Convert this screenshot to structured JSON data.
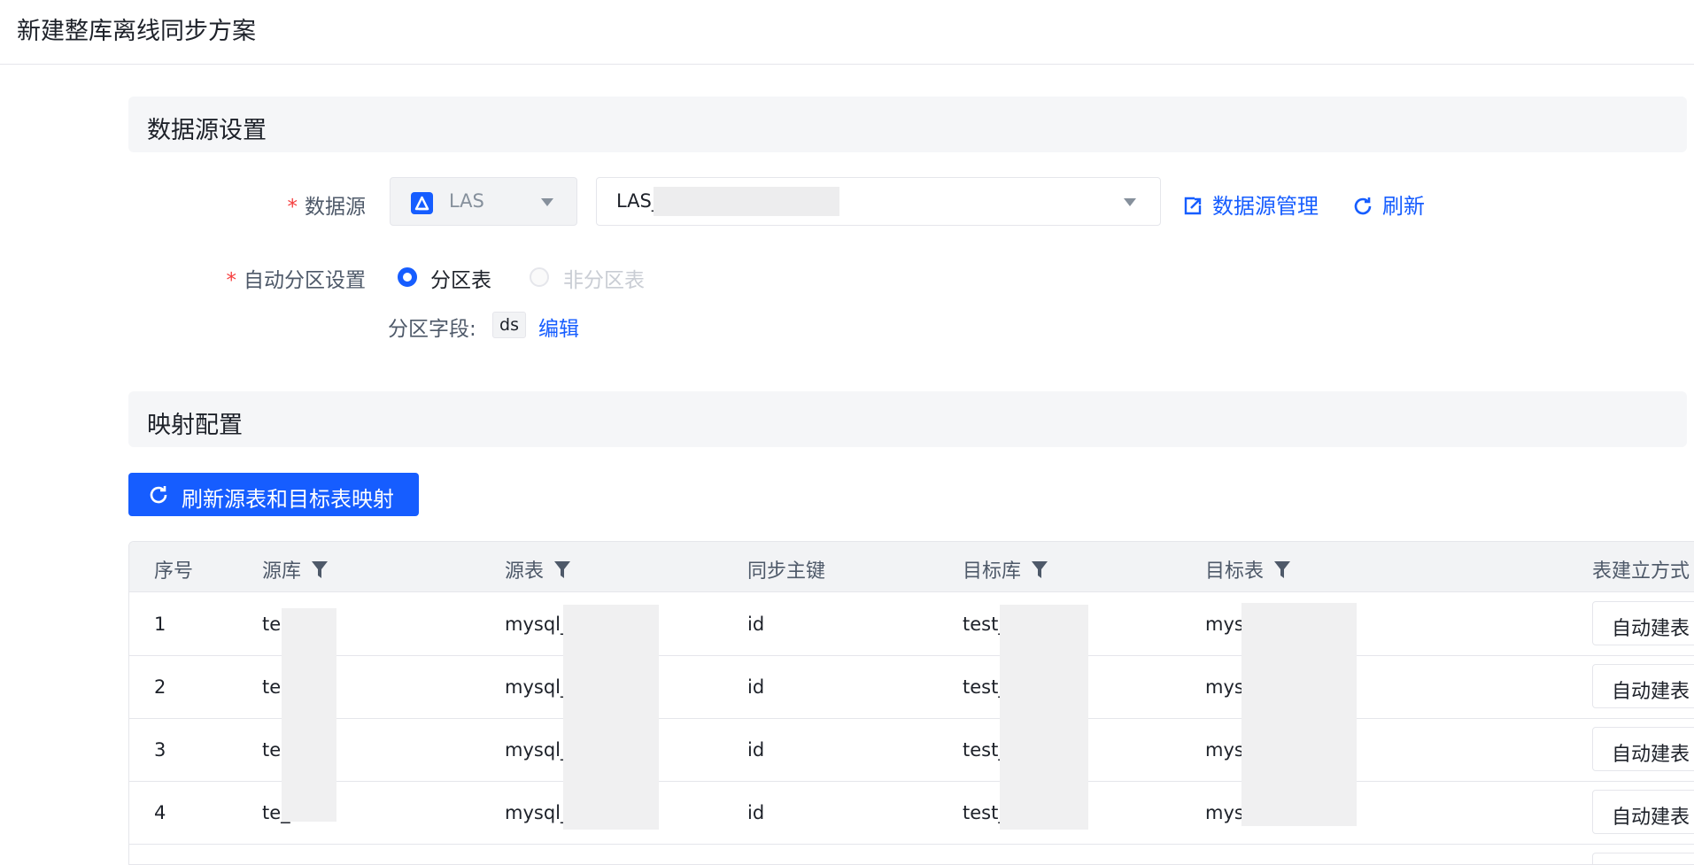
{
  "page_title": "新建整库离线同步方案",
  "datasource_section": {
    "title": "数据源设置",
    "datasource_label": "数据源",
    "datasource_type": "LAS",
    "datasource_name": "LAS_",
    "manage_link": "数据源管理",
    "refresh_link": "刷新",
    "partition_label": "自动分区设置",
    "partition_options": [
      "分区表",
      "非分区表"
    ],
    "partition_selected": "分区表",
    "partition_field_label": "分区字段:",
    "partition_field_value": "ds",
    "edit_link": "编辑"
  },
  "mapping_section": {
    "title": "映射配置",
    "refresh_button": "刷新源表和目标表映射",
    "columns": [
      "序号",
      "源库",
      "源表",
      "同步主键",
      "目标库",
      "目标表",
      "表建立方式"
    ],
    "filterable_columns": [
      "源库",
      "源表",
      "目标库",
      "目标表"
    ],
    "rows": [
      {
        "index": "1",
        "source_db": "te",
        "source_table": "mysql_",
        "primary_key": "id",
        "target_db": "test_",
        "target_table": "mys",
        "create_mode": "自动建表"
      },
      {
        "index": "2",
        "source_db": "te",
        "source_table": "mysql_",
        "primary_key": "id",
        "target_db": "test_",
        "target_table": "mys",
        "create_mode": "自动建表"
      },
      {
        "index": "3",
        "source_db": "te",
        "source_table": "mysql_",
        "primary_key": "id",
        "target_db": "test_",
        "target_table": "mys",
        "create_mode": "自动建表"
      },
      {
        "index": "4",
        "source_db": "te_",
        "source_table": "mysql_",
        "primary_key": "id",
        "target_db": "test_",
        "target_table": "mys",
        "create_mode": "自动建表"
      }
    ]
  },
  "colors": {
    "primary": "#165dff",
    "required": "#f53f3f",
    "section_bg": "#f5f6f8"
  },
  "icons": [
    "las-logo-icon",
    "chevron-down-icon",
    "external-link-icon",
    "refresh-icon",
    "filter-icon"
  ]
}
